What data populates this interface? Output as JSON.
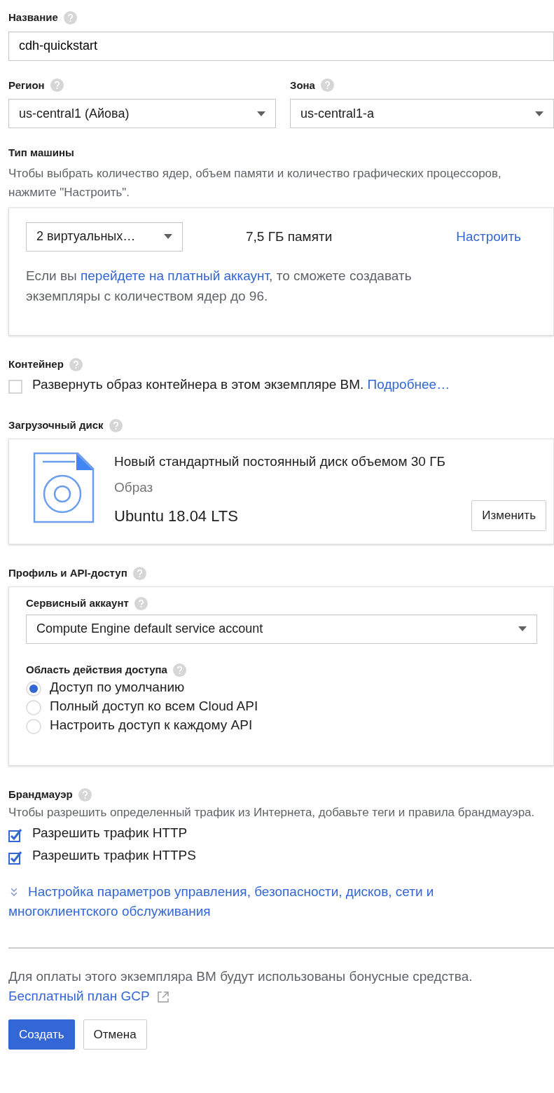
{
  "name_field": {
    "label": "Название",
    "value": "cdh-quickstart"
  },
  "region": {
    "label": "Регион",
    "value": "us-central1 (Айова)"
  },
  "zone": {
    "label": "Зона",
    "value": "us-central1-a"
  },
  "machine_type": {
    "label": "Тип машины",
    "hint": "Чтобы выбрать количество ядер, объем памяти и количество графических процессоров, нажмите \"Настроить\".",
    "cores": "2 виртуальных…",
    "memory": "7,5 ГБ памяти",
    "customize": "Настроить",
    "note_before": "Если вы ",
    "note_link": "перейдете на платный аккаунт",
    "note_after": ", то сможете создавать экземпляры с количеством ядер до 96."
  },
  "container": {
    "label": "Контейнер",
    "checkbox_label": "Развернуть образ контейнера в этом экземпляре ВМ.",
    "checked": false,
    "link": "Подробнее…"
  },
  "boot_disk": {
    "label": "Загрузочный диск",
    "description": "Новый стандартный постоянный диск объемом 30 ГБ",
    "image_label": "Образ",
    "image": "Ubuntu 18.04 LTS",
    "button": "Изменить"
  },
  "identity": {
    "label": "Профиль и API-доступ",
    "account_label": "Сервисный аккаунт",
    "account": "Compute Engine default service account",
    "scope_label": "Область действия доступа",
    "scopes": [
      {
        "label": "Доступ по умолчанию",
        "selected": true
      },
      {
        "label": "Полный доступ ко всем Cloud API",
        "selected": false
      },
      {
        "label": "Настроить доступ к каждому API",
        "selected": false
      }
    ]
  },
  "firewall": {
    "label": "Брандмауэр",
    "hint": "Чтобы разрешить определенный трафик из Интернета, добавьте теги и правила брандмауэра.",
    "options": [
      {
        "label": "Разрешить трафик HTTP",
        "checked": true
      },
      {
        "label": "Разрешить трафик HTTPS",
        "checked": true
      }
    ]
  },
  "advanced_link": "Настройка параметров управления, безопасности, дисков, сети и многоклиентского обслуживания",
  "billing": {
    "text": "Для оплаты этого экземпляра ВМ будут использованы бонусные средства.",
    "link": "Бесплатный план GCP"
  },
  "buttons": [
    {
      "label": "Создать",
      "kind": "primary"
    },
    {
      "label": "Отмена",
      "kind": "secondary"
    }
  ]
}
